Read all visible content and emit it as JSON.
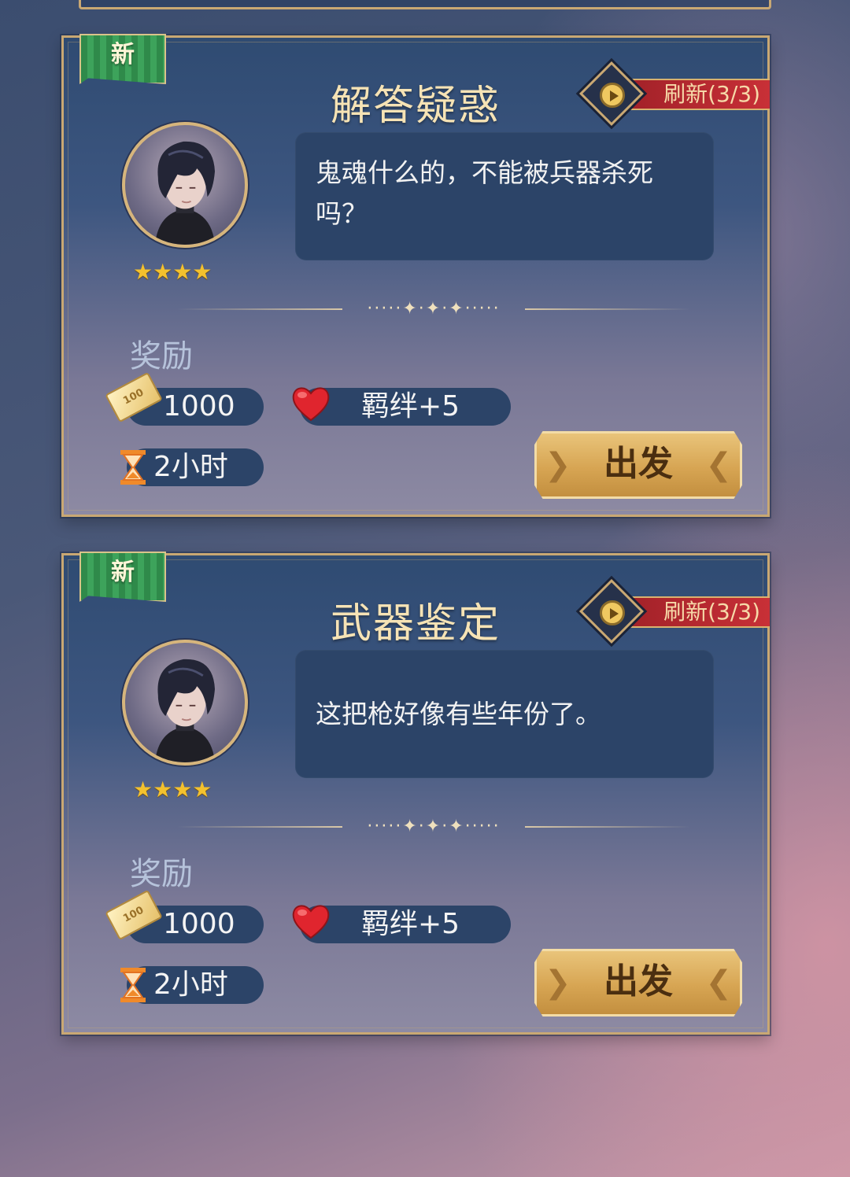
{
  "cards": [
    {
      "badge": "新",
      "title": "解答疑惑",
      "refresh": "刷新(3/3)",
      "stars": "★★★★",
      "dialogue": "鬼魂什么的，不能被兵器杀死吗？",
      "divider": "·····✦·✦·✦·····",
      "reward_label": "奖励",
      "coin_icon_text": "100",
      "coin_amount": "1000",
      "bond": "羁绊+5",
      "duration": "2小时",
      "go_label": "出发"
    },
    {
      "badge": "新",
      "title": "武器鉴定",
      "refresh": "刷新(3/3)",
      "stars": "★★★★",
      "dialogue": "这把枪好像有些年份了。",
      "divider": "·····✦·✦·✦·····",
      "reward_label": "奖励",
      "coin_icon_text": "100",
      "coin_amount": "1000",
      "bond": "羁绊+5",
      "duration": "2小时",
      "go_label": "出发"
    }
  ],
  "icons": {
    "badge": "new-badge",
    "refresh": "play-circle-icon",
    "coin": "banknote-icon",
    "bond": "heart-icon",
    "time": "hourglass-icon"
  },
  "colors": {
    "gold_border": "#c9a873",
    "title": "#f6e3b5",
    "refresh_red": "#c83037",
    "go_button": "#d7a553",
    "badge_green": "#3da35b",
    "star": "#f3c12e"
  }
}
